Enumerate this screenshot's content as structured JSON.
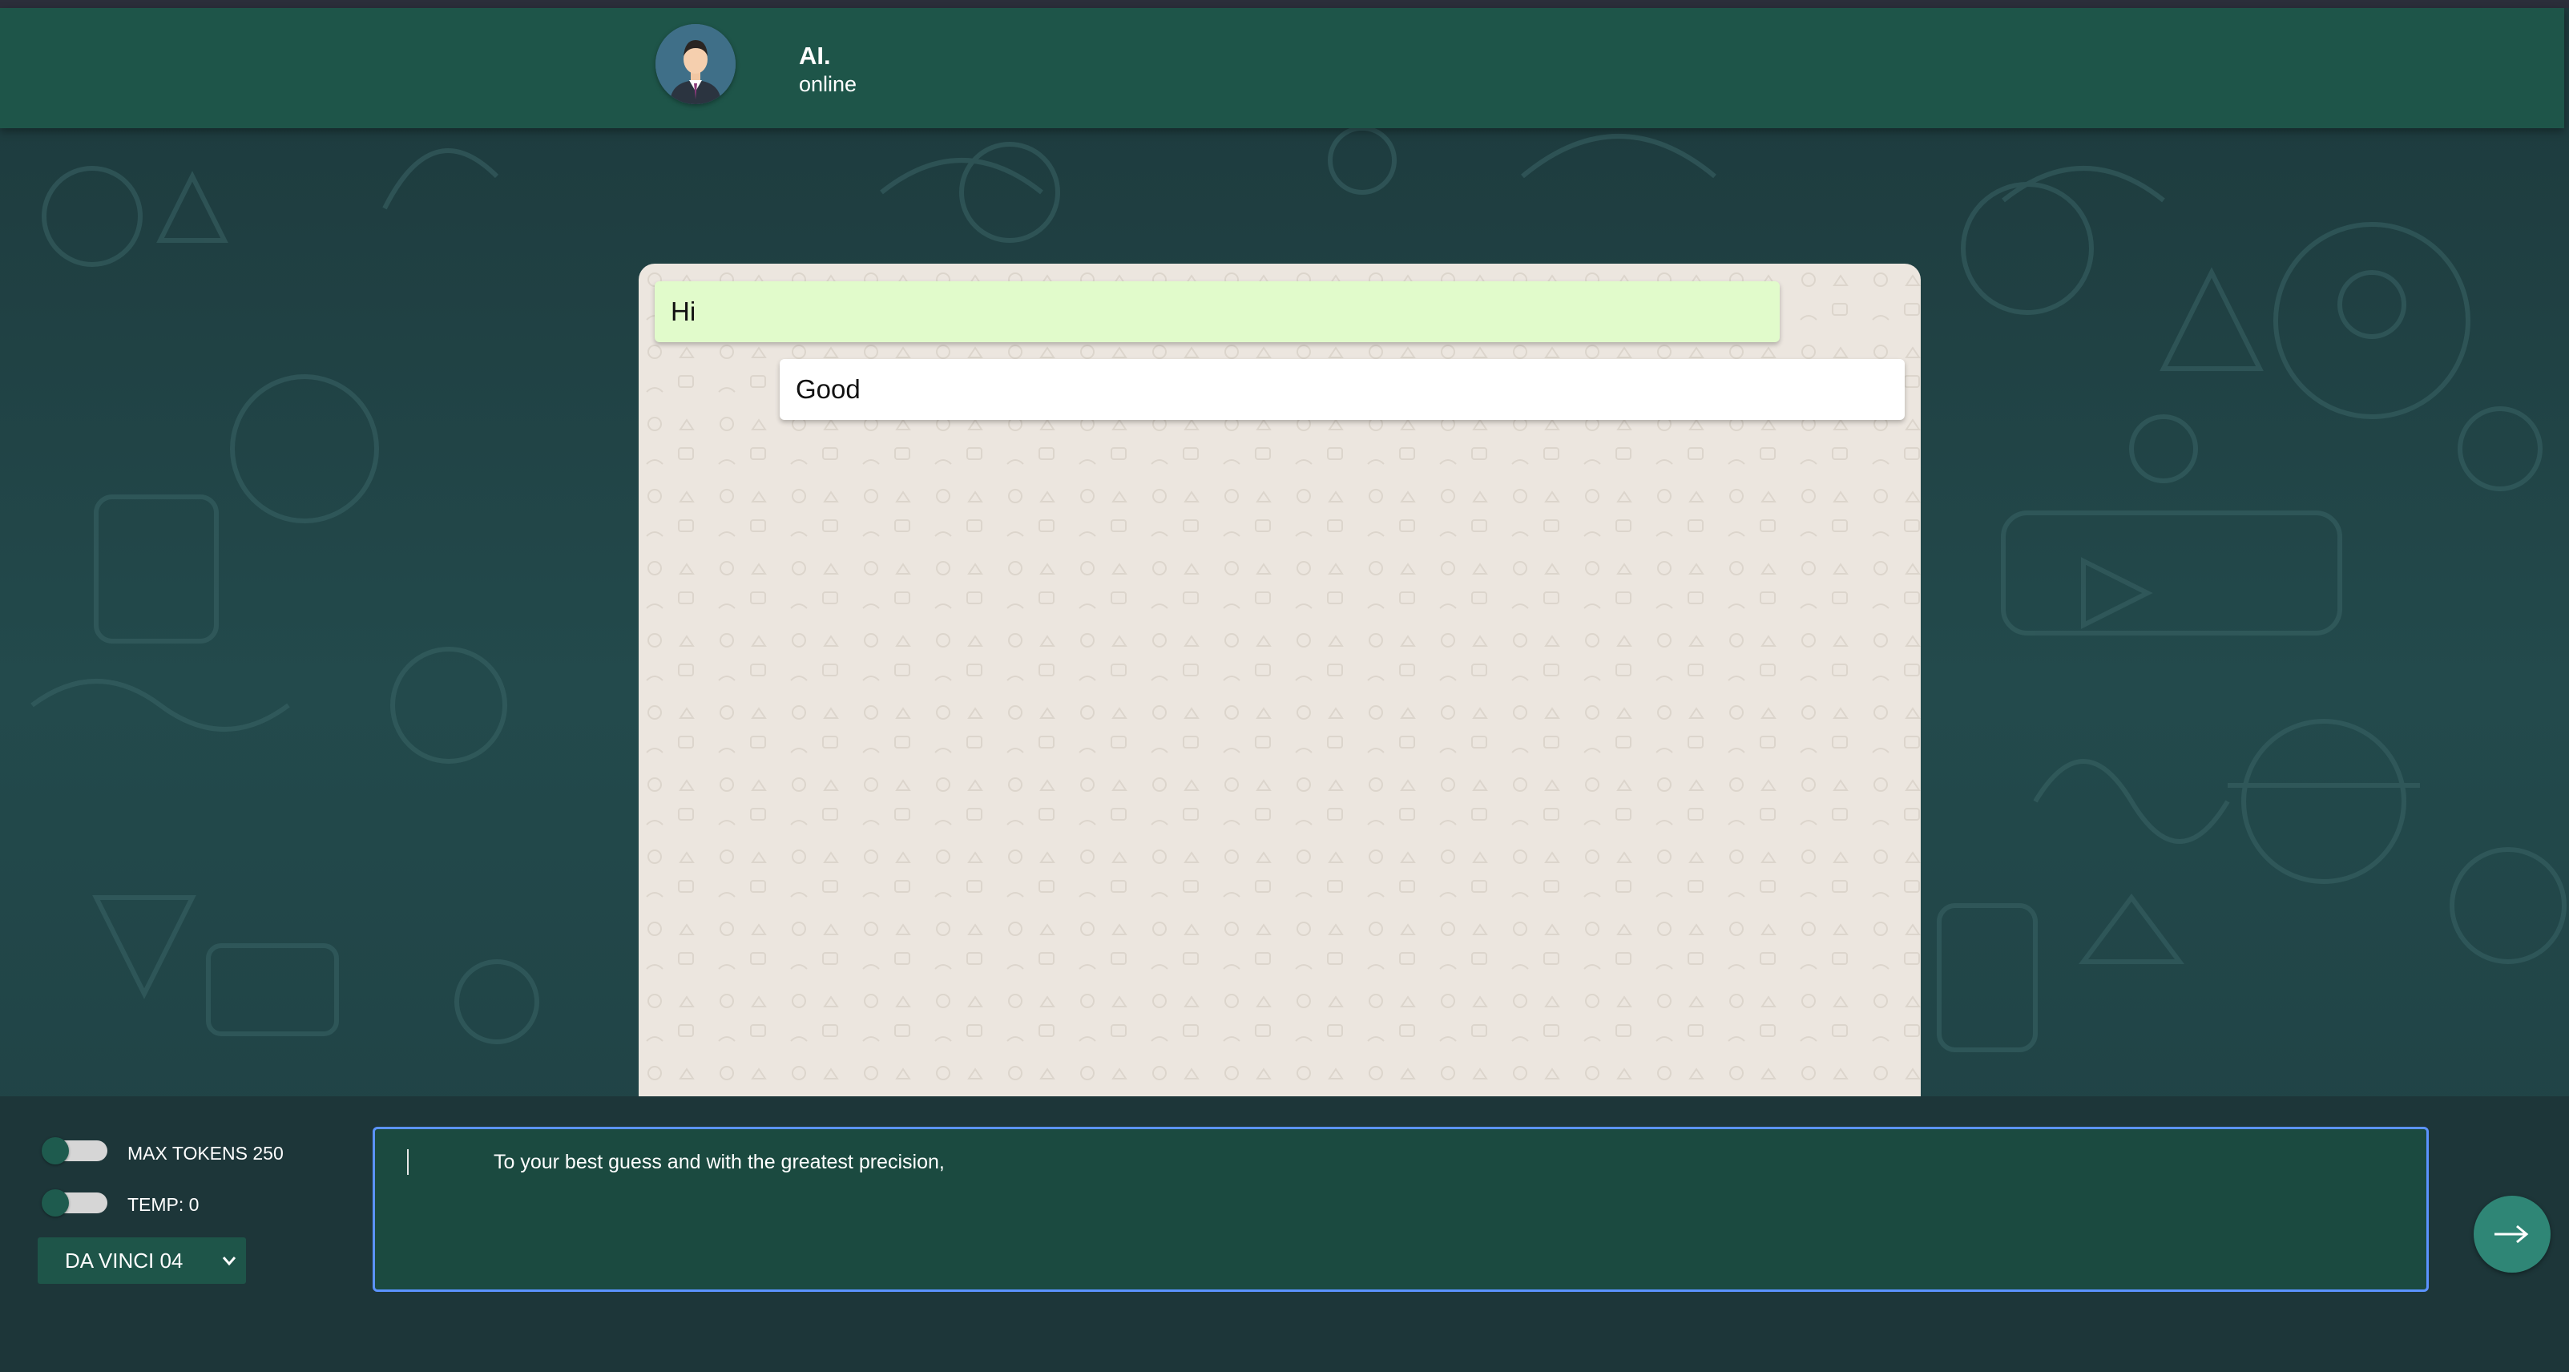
{
  "header": {
    "name": "AI.",
    "status": "online",
    "avatar_icon": "person-avatar-icon"
  },
  "messages": [
    {
      "role": "user",
      "text": "Hi"
    },
    {
      "role": "ai",
      "text": "Good"
    }
  ],
  "controls": {
    "max_tokens_label": "MAX TOKENS 250",
    "temp_label": "TEMP: 0",
    "model_select": "DA VINCI 04"
  },
  "prompt": {
    "value": "To your best guess and with the greatest precision,"
  },
  "send_icon": "arrow-right-icon",
  "colors": {
    "header_bg": "#1e5549",
    "user_bubble": "#e1fbcb",
    "ai_bubble": "#ffffff",
    "focus_border": "#5b93ff",
    "send_button": "#2f8676"
  }
}
